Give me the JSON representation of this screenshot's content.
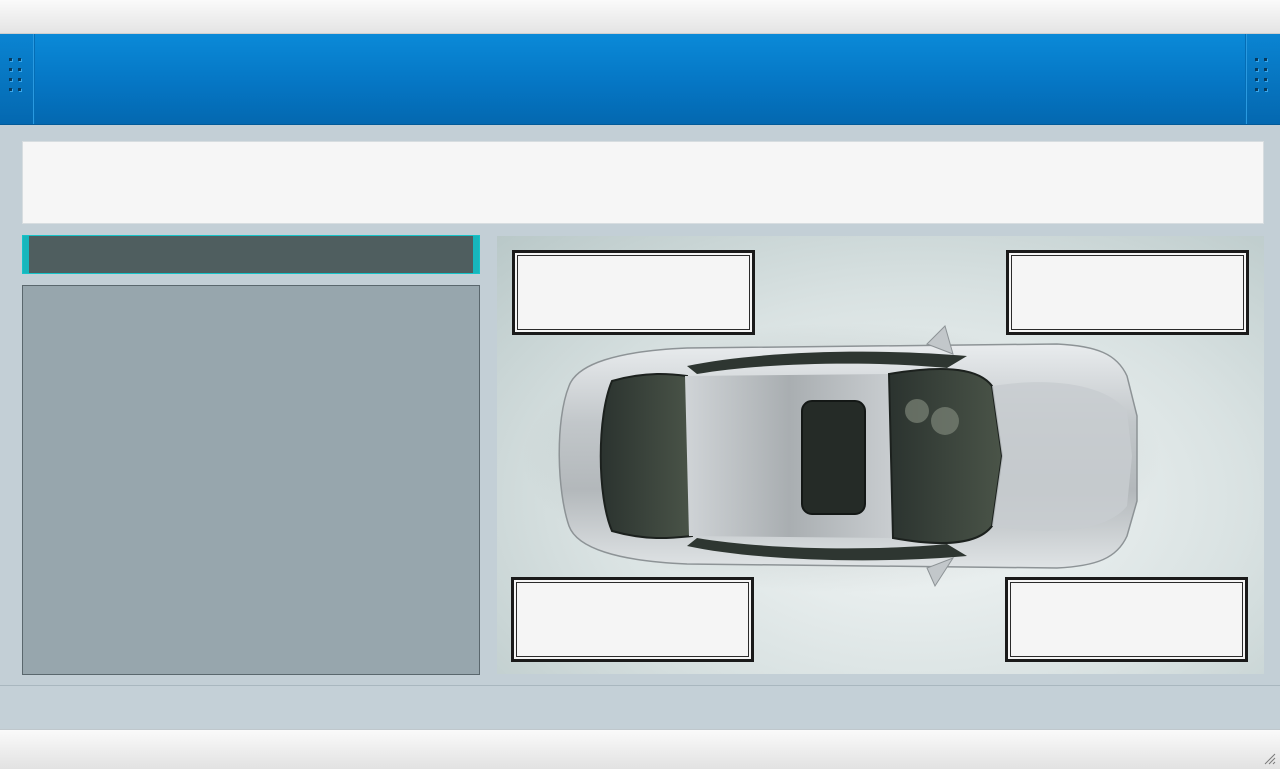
{
  "window": {
    "title": ""
  },
  "header": {
    "title": ""
  },
  "headline": {
    "text": ""
  },
  "selector": {
    "label": ""
  },
  "info_panel": {
    "text": ""
  },
  "car_diagram": {
    "image": "car-top-view",
    "wheels": {
      "front_left": "",
      "front_right": "",
      "rear_left": "",
      "rear_right": ""
    }
  },
  "footer": {
    "text": ""
  },
  "colors": {
    "header_blue": "#0576c4",
    "selector_bg": "#4f5e5f",
    "selector_accent": "#17b6bc",
    "info_bg": "#97a6ad",
    "page_bg": "#c3cfd6"
  },
  "icons": {
    "left_grip": "drag-handle-icon",
    "right_grip": "drag-handle-icon",
    "resize": "resize-grip-icon"
  }
}
